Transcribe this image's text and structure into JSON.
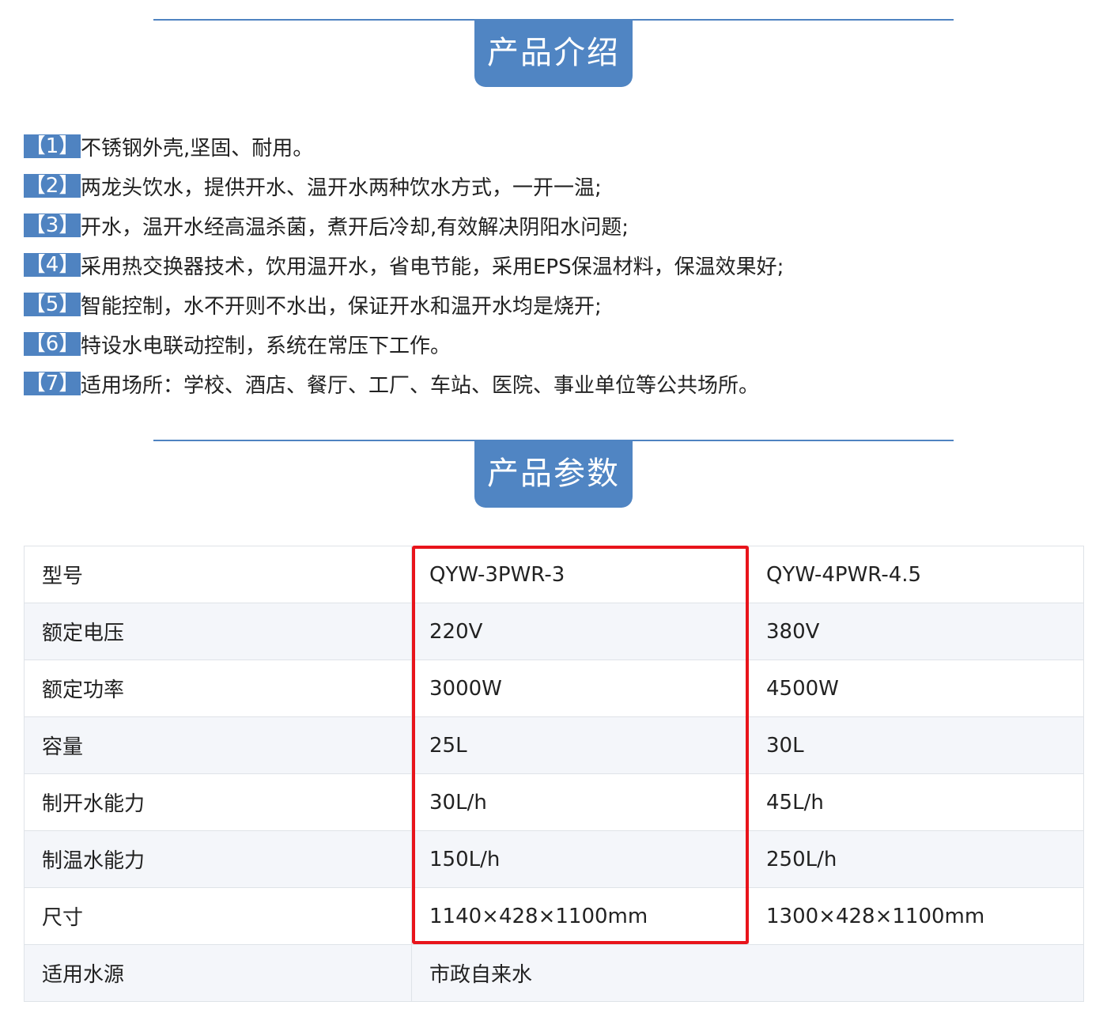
{
  "sections": {
    "intro_title": "产品介绍",
    "params_title": "产品参数"
  },
  "features": [
    {
      "badge": "【1】",
      "text": "不锈钢外壳,坚固、耐用。"
    },
    {
      "badge": "【2】",
      "text": "两龙头饮水，提供开水、温开水两种饮水方式，一开一温;"
    },
    {
      "badge": "【3】",
      "text": "开水，温开水经高温杀菌，煮开后冷却,有效解决阴阳水问题;"
    },
    {
      "badge": "【4】",
      "text": "采用热交换器技术，饮用温开水，省电节能，采用EPS保温材料，保温效果好;"
    },
    {
      "badge": "【5】",
      "text": "智能控制，水不开则不水出，保证开水和温开水均是烧开;"
    },
    {
      "badge": "【6】",
      "text": "特设水电联动控制，系统在常压下工作。"
    },
    {
      "badge": "【7】",
      "text": "适用场所：学校、酒店、餐厅、工厂、车站、医院、事业单位等公共场所。"
    }
  ],
  "params": {
    "rows": [
      {
        "label": "型号",
        "v1": "QYW-3PWR-3",
        "v2": "QYW-4PWR-4.5"
      },
      {
        "label": "额定电压",
        "v1": "220V",
        "v2": "380V"
      },
      {
        "label": "额定功率",
        "v1": "3000W",
        "v2": "4500W"
      },
      {
        "label": "容量",
        "v1": "25L",
        "v2": "30L"
      },
      {
        "label": "制开水能力",
        "v1": "30L/h",
        "v2": "45L/h"
      },
      {
        "label": "制温水能力",
        "v1": "150L/h",
        "v2": "250L/h"
      },
      {
        "label": "尺寸",
        "v1": "1140×428×1100mm",
        "v2": "1300×428×1100mm"
      }
    ],
    "water_source": {
      "label": "适用水源",
      "value": "市政自来水"
    }
  },
  "colors": {
    "accent": "#4f83c1",
    "highlight": "#e8141b"
  }
}
